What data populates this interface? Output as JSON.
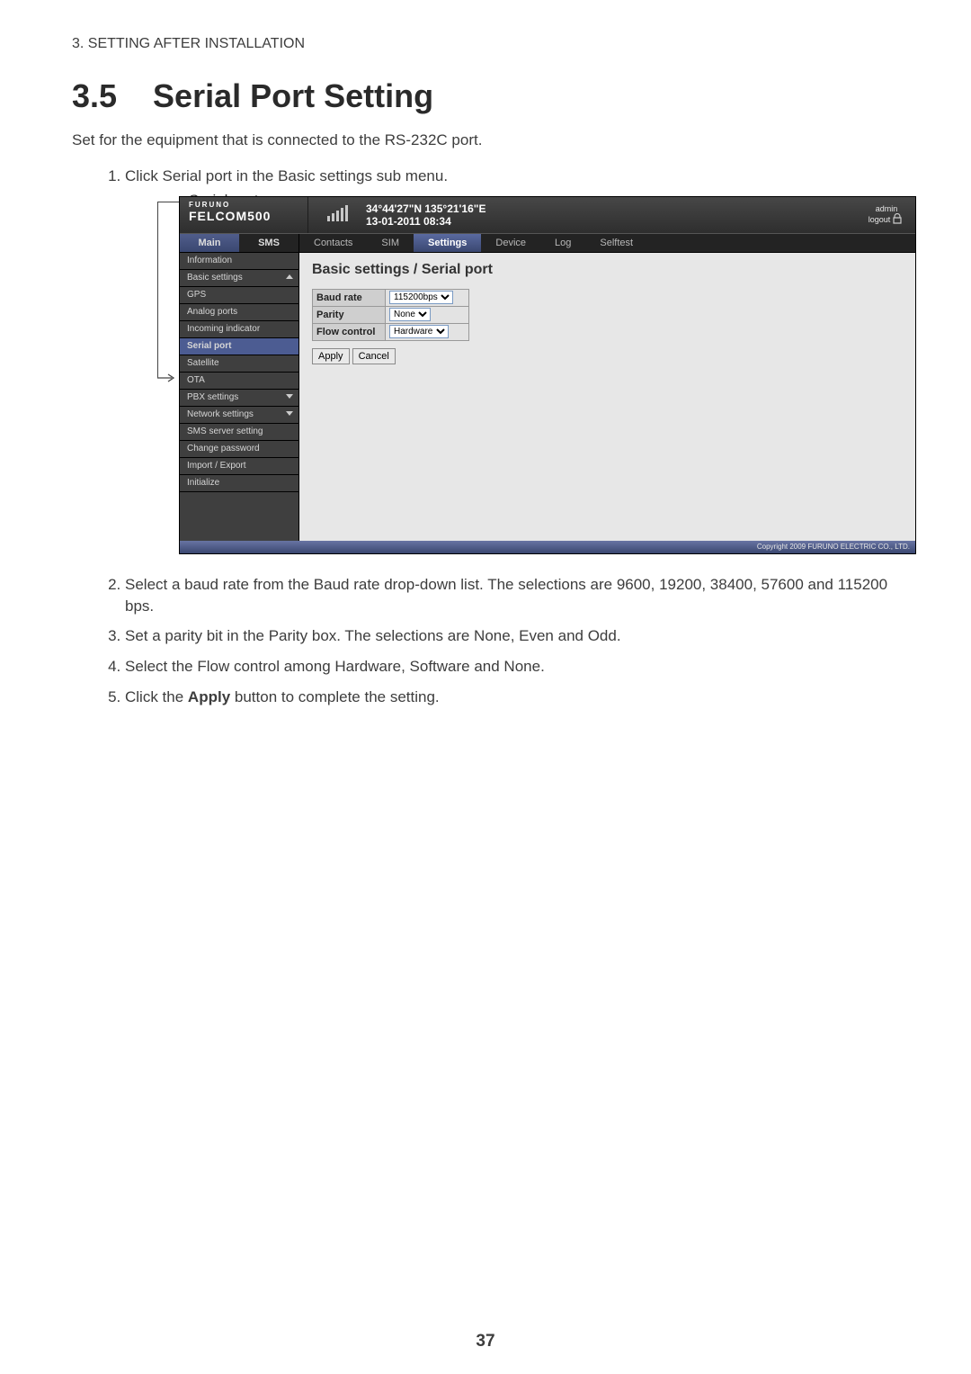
{
  "doc": {
    "chapter_line": "3.  SETTING AFTER INSTALLATION",
    "section_number": "3.5",
    "section_title": "Serial Port Setting",
    "intro": "Set for the equipment that is connected to the RS-232C port.",
    "step1": "Click Serial port in the Basic settings sub menu.",
    "callout_label": "Serial port",
    "step2": "Select a baud rate from the Baud rate drop-down list. The selections are 9600, 19200, 38400, 57600 and 115200 bps.",
    "step3": "Set a parity bit in the Parity box. The selections are None, Even and Odd.",
    "step4": "Select the Flow control among Hardware, Software and None.",
    "step5_a": "Click the ",
    "step5_bold": "Apply",
    "step5_b": " button to complete the setting.",
    "page_number": "37"
  },
  "ui": {
    "brand_small": "FURUNO",
    "brand_product": "FELCOM500",
    "coords_line1": "34°44'27\"N   135°21'16\"E",
    "coords_line2": "13-01-2011 08:34",
    "admin_text": "admin",
    "logout_text": "logout",
    "side_tab1": "Main",
    "side_tab2": "SMS",
    "tabs": {
      "t1": "Contacts",
      "t2": "SIM",
      "t3": "Settings",
      "t4": "Device",
      "t5": "Log",
      "t6": "Selftest"
    },
    "sidebar": {
      "s1": "Information",
      "s2": "Basic settings",
      "s3": "GPS",
      "s4": "Analog ports",
      "s5": "Incoming indicator",
      "s6": "Serial port",
      "s7": "Satellite",
      "s8": "OTA",
      "s9": "PBX settings",
      "s10": "Network settings",
      "s11": "SMS server setting",
      "s12": "Change password",
      "s13": "Import / Export",
      "s14": "Initialize"
    },
    "main_title": "Basic settings / Serial port",
    "form": {
      "baud_label": "Baud rate",
      "baud_value": "115200bps",
      "parity_label": "Parity",
      "parity_value": "None",
      "flow_label": "Flow control",
      "flow_value": "Hardware"
    },
    "buttons": {
      "apply": "Apply",
      "cancel": "Cancel"
    },
    "footer": "Copyright 2009 FURUNO ELECTRIC CO., LTD."
  }
}
